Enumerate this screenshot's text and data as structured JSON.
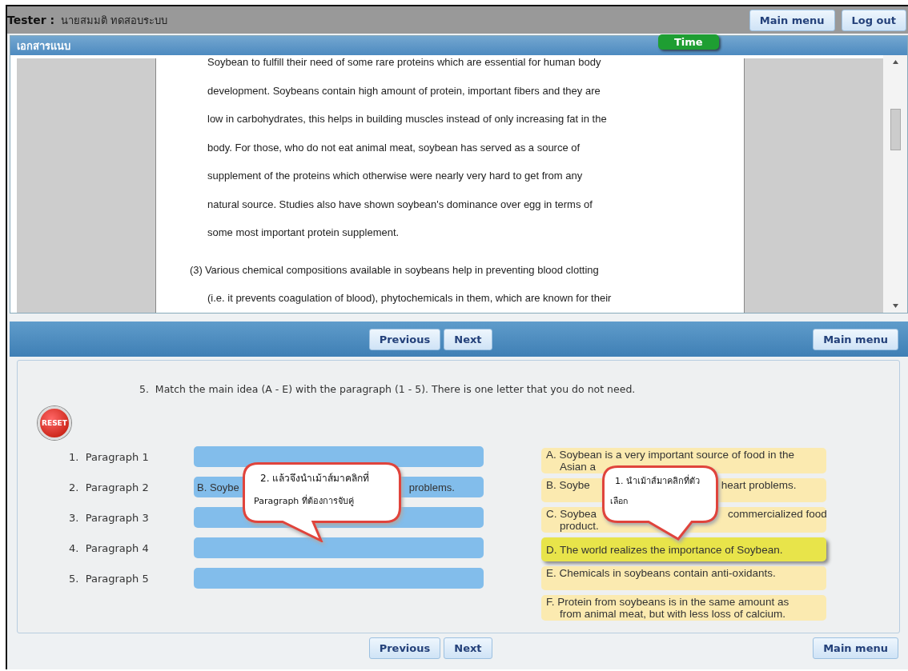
{
  "header": {
    "tester_label": "Tester :",
    "tester_name": "นายสมมติ ทดสอบระบบ",
    "buttons": [
      "Main menu",
      "Log out"
    ]
  },
  "document_panel": {
    "title": "เอกสารแนบ",
    "timer": "Time",
    "paragraphs": [
      {
        "lines": [
          "Soybean to fulfill their need of some rare proteins which are essential for human body",
          "development. Soybeans contain high amount of protein, important fibers and they are",
          "low in carbohydrates, this helps in building muscles instead of only increasing fat in the",
          "body. For those, who do not eat animal meat, soybean has served as a source of",
          "supplement of the proteins which otherwise were nearly very hard to get from any",
          "natural source. Studies also have shown soybean's dominance over egg in terms of",
          "some most important protein supplement."
        ]
      },
      {
        "number": "(3)",
        "lines": [
          "Various chemical compositions available in soybeans help in preventing blood clotting",
          "(i.e. it prevents coagulation of blood), phytochemicals in them, which are known for their"
        ]
      }
    ]
  },
  "nav_top": {
    "buttons": [
      "Previous",
      "Next"
    ],
    "main_menu": "Main menu"
  },
  "question": {
    "number": "5.",
    "text": "Match the main idea (A - E) with the paragraph (1 - 5). There is one letter that you do not need.",
    "reset": "RESET",
    "paragraphs": [
      {
        "number": "1.",
        "label": "Paragraph 1"
      },
      {
        "number": "2.",
        "label": "Paragraph 2",
        "answer": [
          "B. Soybe",
          "problems."
        ]
      },
      {
        "number": "3.",
        "label": "Paragraph 3"
      },
      {
        "number": "4.",
        "label": "Paragraph 4"
      },
      {
        "number": "5.",
        "label": "Paragraph 5"
      }
    ],
    "options": [
      {
        "lines": [
          [
            "A. Soybean is a very important source of food in the"
          ],
          [
            "Asian a"
          ]
        ],
        "selected": false
      },
      {
        "lines": [
          [
            "B. Soybe",
            "heart problems."
          ]
        ],
        "selected": false
      },
      {
        "lines": [
          [
            "C. Soybea",
            "commercialized food"
          ],
          [
            "product."
          ]
        ],
        "selected": false
      },
      {
        "lines": [
          [
            "D. The world realizes the importance of Soybean."
          ]
        ],
        "selected": true
      },
      {
        "lines": [
          [
            "E. Chemicals in soybeans contain anti-oxidants."
          ]
        ],
        "selected": false
      },
      {
        "lines": [
          [
            "F. Protein from soybeans is in the same amount as"
          ],
          [
            "from animal meat, but with less loss of calcium."
          ]
        ],
        "selected": false
      }
    ],
    "callouts": [
      {
        "lines": [
          "2. แล้วจึงนำเม้าส์มาคลิกที่",
          "Paragraph ที่ต้องการจับคู่"
        ]
      },
      {
        "lines": [
          "1. นำเม้าส์มาคลิกที่ตัว",
          "เลือก"
        ]
      }
    ]
  },
  "nav_bottom": {
    "buttons": [
      "Previous",
      "Next"
    ],
    "main_menu": "Main menu"
  }
}
